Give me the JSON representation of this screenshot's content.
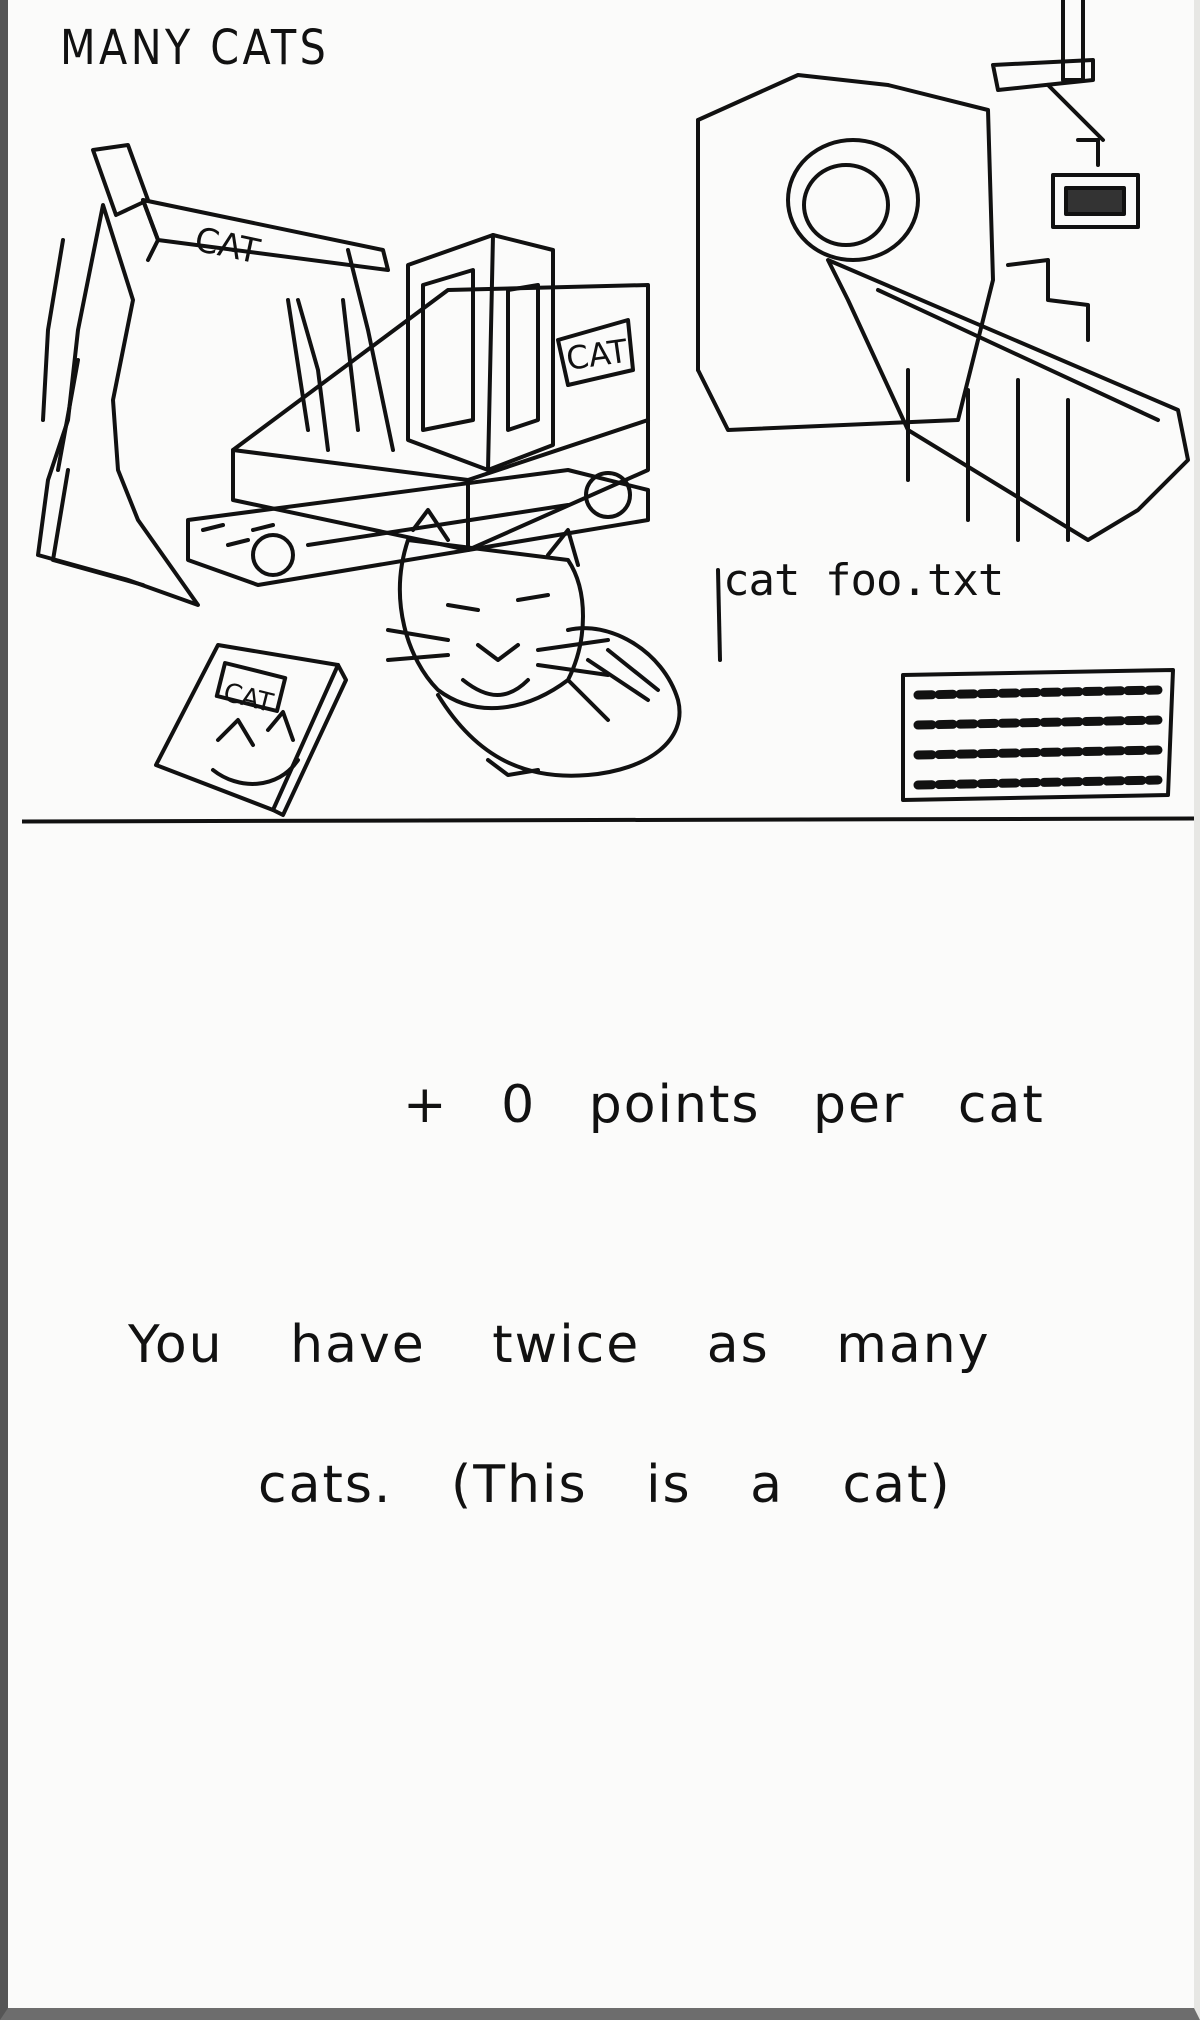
{
  "card": {
    "title": "MANY CATS",
    "terminal_command": "cat foo.txt",
    "badge_label_arm": "CAT",
    "badge_label_cab": "CAT",
    "badge_label_book": "CAT",
    "effect_text": "+ 0 points per cat",
    "description_line1": "You have twice as many",
    "description_line2": "cats. (This is a cat)"
  }
}
